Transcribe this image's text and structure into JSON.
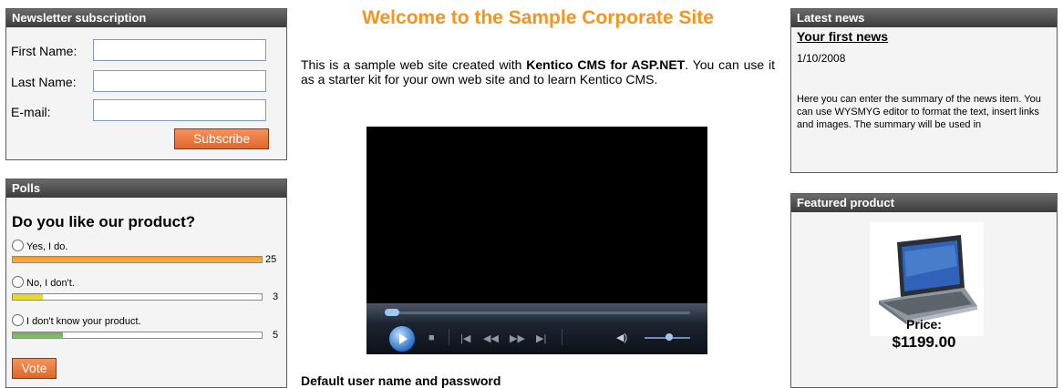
{
  "newsletter": {
    "title": "Newsletter subscription",
    "first_name_label": "First Name:",
    "last_name_label": "Last Name:",
    "email_label": "E-mail:",
    "first_name_value": "",
    "last_name_value": "",
    "email_value": "",
    "subscribe_label": "Subscribe"
  },
  "polls": {
    "title": "Polls",
    "question": "Do you like our product?",
    "answers": [
      {
        "label": "Yes, I do.",
        "count": "25",
        "fraction": 1.0,
        "color": "#f29d1e"
      },
      {
        "label": "No, I don't.",
        "count": "3",
        "fraction": 0.12,
        "color": "#e6d317"
      },
      {
        "label": "I don't know your product.",
        "count": "5",
        "fraction": 0.2,
        "color": "#6fae52"
      }
    ],
    "vote_label": "Vote"
  },
  "main": {
    "title": "Welcome to the Sample Corporate Site",
    "intro_before": "This is a sample web site created with ",
    "intro_bold": "Kentico CMS for ASP.NET",
    "intro_after": ". You can use it as a starter kit for your own web site and to learn Kentico CMS.",
    "defaults_heading": "Default user name and password",
    "accent_color": "#f7941d"
  },
  "video_player": {
    "play_icon": "play-icon",
    "stop_icon": "stop-icon",
    "prev_icon": "previous-icon",
    "rewind_icon": "rewind-icon",
    "forward_icon": "fast-forward-icon",
    "next_icon": "next-icon",
    "volume_icon": "volume-icon"
  },
  "latest_news": {
    "title": "Latest news",
    "item_title": "Your first news",
    "item_date": "1/10/2008",
    "item_summary": "Here you can enter the summary of the news item. You can use WYSMYG editor to format the text, insert links and images. The summary will be used in"
  },
  "featured_product": {
    "title": "Featured product",
    "price_label": "Price:",
    "price_value": "$1199.00"
  }
}
